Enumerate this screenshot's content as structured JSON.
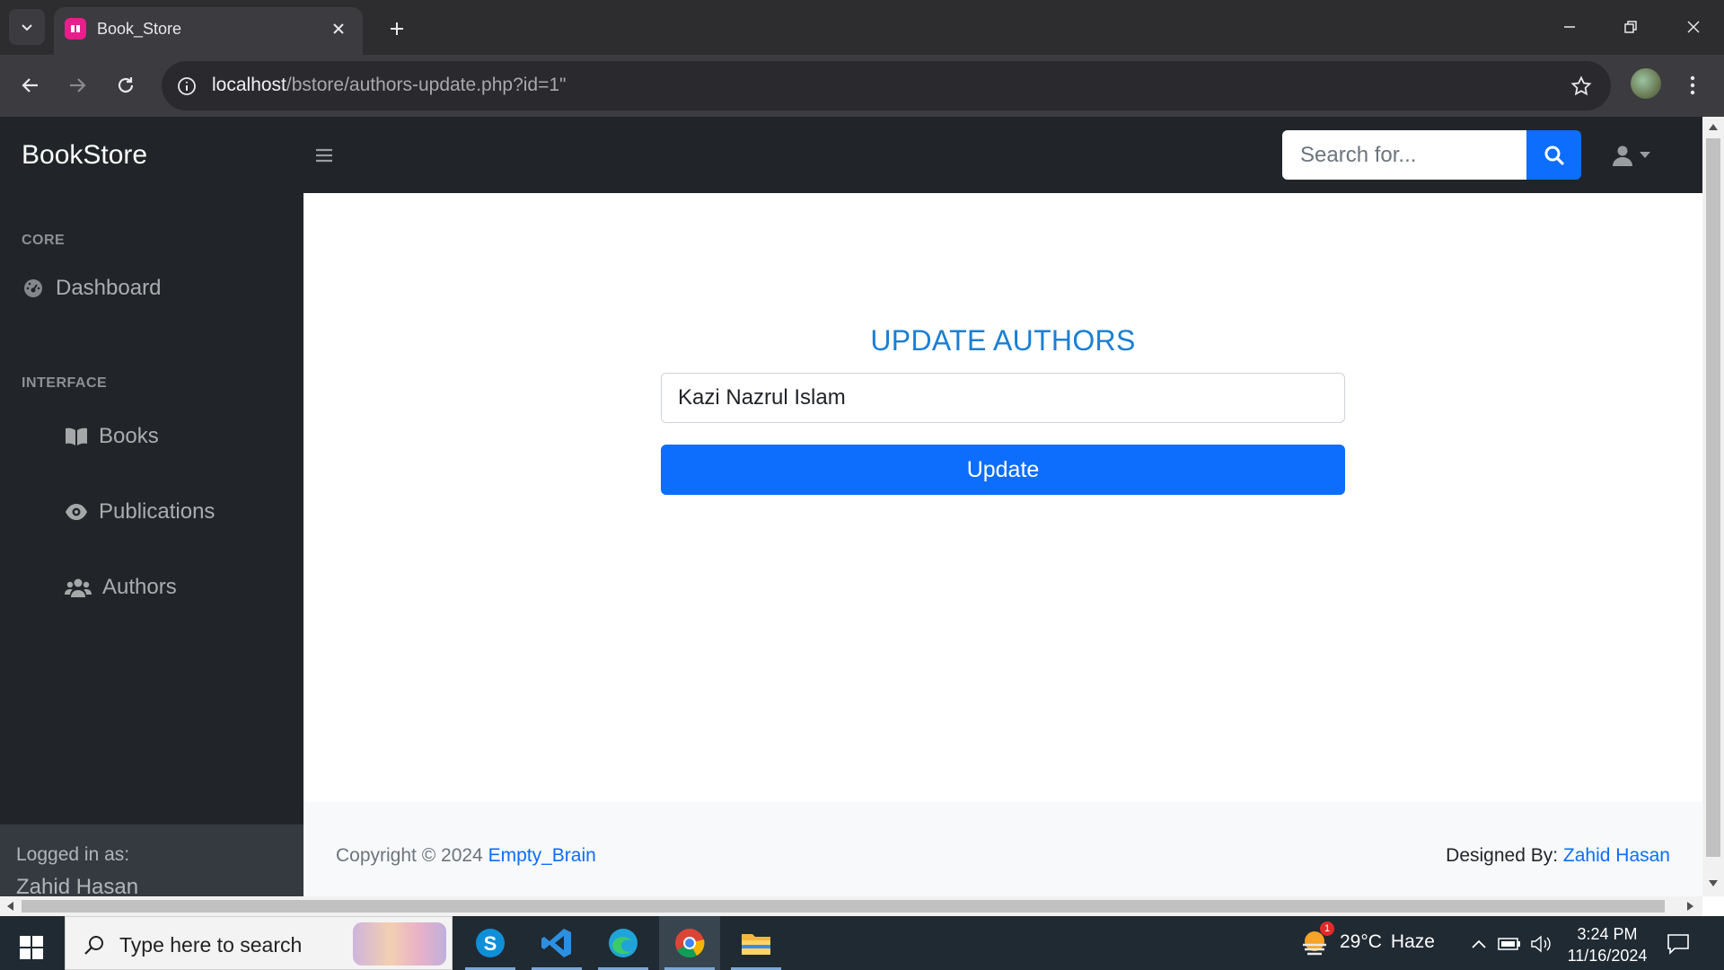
{
  "browser": {
    "tab_title": "Book_Store",
    "url_host": "localhost",
    "url_path": "/bstore/authors-update.php?id=1\""
  },
  "navbar": {
    "brand": "BookStore",
    "search_placeholder": "Search for..."
  },
  "sidebar": {
    "heading_core": "CORE",
    "heading_interface": "INTERFACE",
    "items": [
      {
        "label": "Dashboard",
        "icon": "tachometer-icon"
      },
      {
        "label": "Books",
        "icon": "book-open-icon"
      },
      {
        "label": "Publications",
        "icon": "eye-icon"
      },
      {
        "label": "Authors",
        "icon": "users-icon"
      }
    ],
    "footer_label": "Logged in as:",
    "footer_user": "Zahid Hasan"
  },
  "form": {
    "title": "UPDATE AUTHORS",
    "author_value": "Kazi Nazrul Islam",
    "submit_label": "Update"
  },
  "footer": {
    "copyright": "Copyright © 2024 ",
    "copyright_link": "Empty_Brain",
    "designed_by": "Designed By: ",
    "designer_link": "Zahid Hasan"
  },
  "taskbar": {
    "search_placeholder": "Type here to search",
    "weather_temp": "29°C",
    "weather_desc": "Haze",
    "weather_badge": "1",
    "time": "3:24 PM",
    "date": "11/16/2024"
  },
  "colors": {
    "accent": "#0d6efd",
    "title_blue": "#1a7fd4",
    "sidebar_bg": "#212529"
  }
}
